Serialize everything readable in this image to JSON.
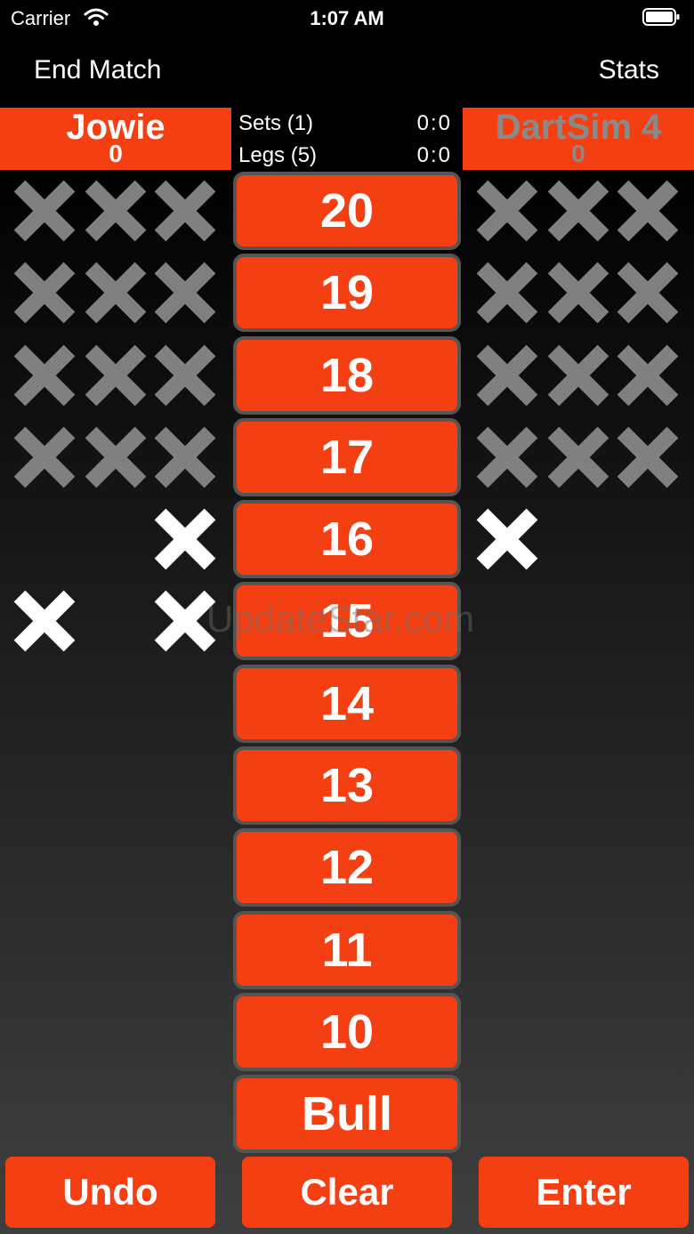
{
  "status_bar": {
    "carrier": "Carrier",
    "time": "1:07 AM"
  },
  "nav": {
    "left_label": "End Match",
    "right_label": "Stats"
  },
  "players": {
    "left": {
      "name": "Jowie",
      "score": "0"
    },
    "right": {
      "name": "DartSim 4",
      "score": "0"
    }
  },
  "match": {
    "sets_label": "Sets (1)",
    "sets_value": "0:0",
    "legs_label": "Legs (5)",
    "legs_value": "0:0"
  },
  "numbers": [
    "20",
    "19",
    "18",
    "17",
    "16",
    "15",
    "14",
    "13",
    "12",
    "11",
    "10",
    "Bull"
  ],
  "marks": {
    "left": [
      3,
      3,
      3,
      3,
      1,
      2,
      0
    ],
    "right": [
      3,
      3,
      3,
      3,
      1,
      0,
      0
    ]
  },
  "buttons": {
    "undo": "Undo",
    "clear": "Clear",
    "enter": "Enter"
  },
  "watermark": "UpdateStar.com",
  "colors": {
    "accent": "#f33f12",
    "closed_mark": "#808080",
    "open_mark": "#ffffff"
  }
}
